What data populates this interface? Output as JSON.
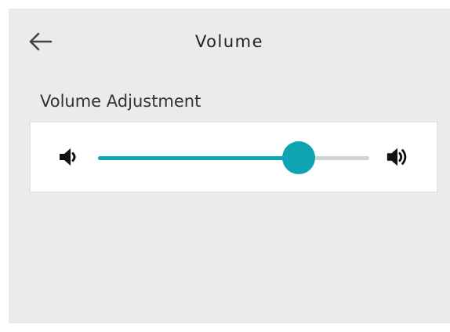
{
  "header": {
    "title": "Volume",
    "back_icon": "arrow-left-icon"
  },
  "section": {
    "label": "Volume Adjustment"
  },
  "volume_slider": {
    "value_fraction": 0.74,
    "low_icon": "speaker-low-icon",
    "high_icon": "speaker-high-icon"
  },
  "colors": {
    "accent": "#0ea5b2",
    "track": "#cfd3d6",
    "background": "#ebebeb",
    "card": "#ffffff"
  }
}
